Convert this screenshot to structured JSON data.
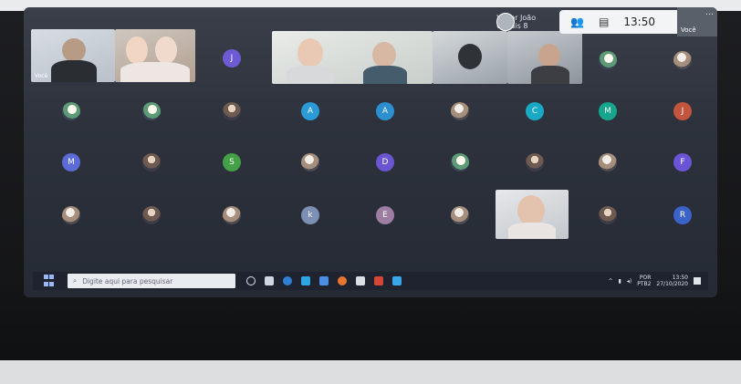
{
  "meeting": {
    "caller_name": "Victor João",
    "caller_sub": "e mais 8",
    "time": "13:50",
    "self_label": "Você",
    "self_tile_label": "Você",
    "more_icon": "…"
  },
  "participants": [
    {
      "initial": "J",
      "color": "#6d5bd6"
    },
    {
      "initial": "A",
      "color": "#2a9bd6"
    },
    {
      "initial": "A",
      "color": "#2b8fd0"
    },
    {
      "initial": "C",
      "color": "#1aa9c5"
    },
    {
      "initial": "M",
      "color": "#16a58d"
    },
    {
      "initial": "J",
      "color": "#c2553e"
    },
    {
      "initial": "M",
      "color": "#5c6bd6"
    },
    {
      "initial": "S",
      "color": "#43a047"
    },
    {
      "initial": "D",
      "color": "#6b55d2"
    },
    {
      "initial": "F",
      "color": "#6b55d6"
    },
    {
      "initial": "k",
      "color": "#7d8fb5"
    },
    {
      "initial": "E",
      "color": "#9e7da3"
    },
    {
      "initial": "R",
      "color": "#3a62c7"
    }
  ],
  "taskbar": {
    "search_placeholder": "Digite aqui para pesquisar",
    "lang": "POR",
    "lang2": "PTB2",
    "clock": "13:50",
    "date": "27/10/2020"
  },
  "icons": [
    "search-icon",
    "task-view-icon",
    "edge-icon",
    "chrome-icon",
    "mail-icon",
    "firefox-icon",
    "store-icon",
    "pdf-icon",
    "photos-icon"
  ]
}
